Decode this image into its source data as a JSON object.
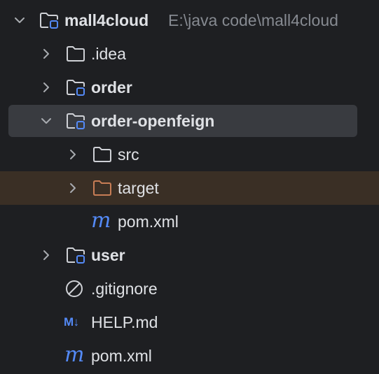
{
  "tree": {
    "root": {
      "name": "mall4cloud",
      "path": "E:\\java code\\mall4cloud"
    },
    "idea": {
      "name": ".idea"
    },
    "order": {
      "name": "order"
    },
    "order_openfeign": {
      "name": "order-openfeign"
    },
    "src": {
      "name": "src"
    },
    "target": {
      "name": "target"
    },
    "pom_inner": {
      "name": "pom.xml",
      "icon_glyph": "m"
    },
    "user": {
      "name": "user"
    },
    "gitignore": {
      "name": ".gitignore"
    },
    "help": {
      "name": "HELP.md",
      "icon_glyph": "M↓"
    },
    "pom_root": {
      "name": "pom.xml",
      "icon_glyph": "m"
    }
  },
  "icons": {
    "chevron_collapsed": "chevron-right-icon",
    "chevron_expanded": "chevron-down-icon",
    "folder": "folder-icon",
    "module": "module-folder-icon",
    "excluded_folder": "excluded-folder-icon",
    "maven": "maven-icon",
    "ignore": "ignore-file-icon",
    "markdown": "markdown-icon"
  },
  "colors": {
    "background": "#1e1f22",
    "selection": "#393b40",
    "excluded_row": "#3a2f25",
    "text": "#dfe1e5",
    "hint": "#868a91",
    "accent_blue": "#548af7",
    "excluded_orange": "#c77d55"
  }
}
